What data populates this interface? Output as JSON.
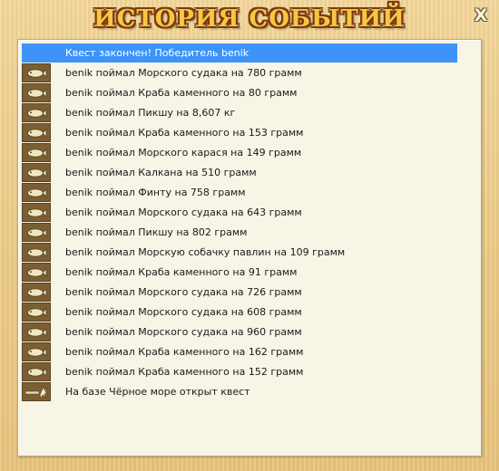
{
  "window": {
    "title": "ИСТОРИЯ СОБЫТИЙ",
    "close_label": "X"
  },
  "events": [
    {
      "text": "Квест закончен! Победитель benik",
      "icon": "none",
      "selected": true
    },
    {
      "text": "benik поймал Морского судака на 780 грамм",
      "icon": "fish-icon"
    },
    {
      "text": "benik поймал Краба каменного на 80 грамм",
      "icon": "fish-icon"
    },
    {
      "text": "benik поймал Пикшу на 8,607 кг",
      "icon": "fish-icon"
    },
    {
      "text": "benik поймал Краба каменного на 153 грамм",
      "icon": "fish-icon"
    },
    {
      "text": "benik поймал Морского карася на 149 грамм",
      "icon": "fish-icon"
    },
    {
      "text": "benik поймал Калкана на 510 грамм",
      "icon": "fish-icon"
    },
    {
      "text": "benik поймал Финту на 758 грамм",
      "icon": "fish-icon"
    },
    {
      "text": "benik поймал Морского судака на 643 грамм",
      "icon": "fish-icon"
    },
    {
      "text": "benik поймал Пикшу на 802 грамм",
      "icon": "fish-icon"
    },
    {
      "text": "benik поймал Морскую собачку павлин на 109 грамм",
      "icon": "fish-icon"
    },
    {
      "text": "benik поймал Краба каменного на 91 грамм",
      "icon": "fish-icon"
    },
    {
      "text": "benik поймал Морского судака на 726 грамм",
      "icon": "fish-icon"
    },
    {
      "text": "benik поймал Морского судака на 608 грамм",
      "icon": "fish-icon"
    },
    {
      "text": "benik поймал Морского судака на 960 грамм",
      "icon": "fish-icon"
    },
    {
      "text": "benik поймал Краба каменного на 162 грамм",
      "icon": "fish-icon"
    },
    {
      "text": "benik поймал Краба каменного на 152 грамм",
      "icon": "fish-icon"
    },
    {
      "text": "На базе Чёрное море открыт квест",
      "icon": "quest-icon"
    }
  ],
  "colors": {
    "selection": "#3d93f7",
    "icon_bg": "#7b5f33",
    "title_fill": "#f7c744",
    "title_outline": "#7a3a10"
  }
}
